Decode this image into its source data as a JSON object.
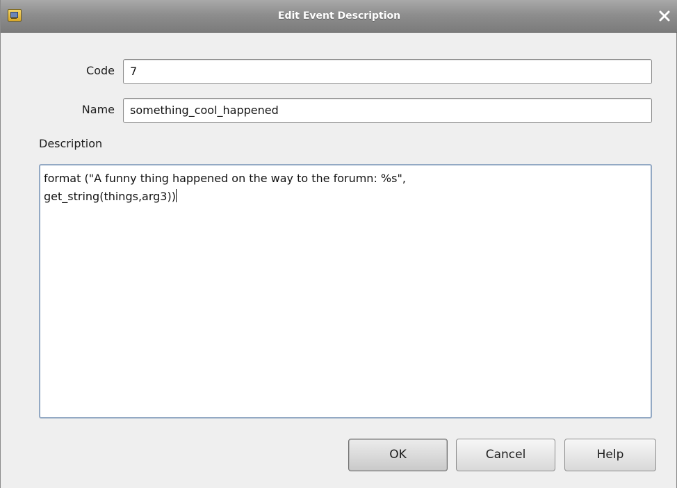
{
  "window": {
    "title": "Edit Event Description",
    "icon": "app-icon",
    "close_icon": "close-icon"
  },
  "form": {
    "code_label": "Code",
    "code_value": "7",
    "name_label": "Name",
    "name_value": "something_cool_happened",
    "description_label": "Description",
    "description_lines": [
      "format (\"A funny thing happened on the way to the forumn: %s\",",
      "get_string(things,arg3))"
    ]
  },
  "buttons": {
    "ok": "OK",
    "cancel": "Cancel",
    "help": "Help"
  },
  "colors": {
    "titlebar": "#8e8e8e",
    "dialog_bg": "#efefef",
    "focus_border": "#93a9c4"
  }
}
